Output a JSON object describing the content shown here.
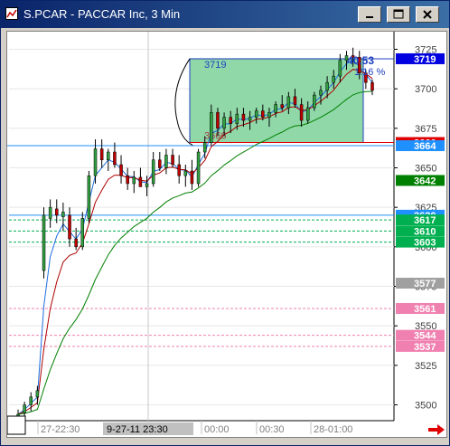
{
  "window": {
    "title": "S.PCAR - PACCAR Inc, 3 Min",
    "colors": {
      "titlebar_start": "#0a246a",
      "titlebar_end": "#3a6ea5"
    }
  },
  "title_buttons": [
    {
      "name": "minimize",
      "icon": "minimize-icon"
    },
    {
      "name": "maximize",
      "icon": "maximize-icon"
    },
    {
      "name": "close",
      "icon": "close-icon"
    }
  ],
  "chart_data": {
    "type": "candlestick",
    "price_axis": {
      "labels": [
        "3725",
        "3700",
        "3675",
        "3650",
        "3625",
        "3600",
        "3575",
        "3550",
        "3525",
        "3500"
      ],
      "ylim": [
        3490,
        3735
      ]
    },
    "time_axis": {
      "labels": [
        "27-22:30",
        "9-27-11  23:30",
        "00:00",
        "00:30",
        "28-01:00"
      ],
      "cursor_label": "9-27-11  23:30"
    },
    "price_markers": [
      {
        "value": 3719,
        "label": "3719",
        "color": "#0000e0"
      },
      {
        "value": 3666,
        "label": "3666",
        "color": "#e00000"
      },
      {
        "value": 3664,
        "label": "3664",
        "color": "#1e90ff"
      },
      {
        "value": 3642,
        "label": "3642",
        "color": "#008000"
      },
      {
        "value": 3620,
        "label": "3620",
        "color": "#1e90ff"
      },
      {
        "value": 3617,
        "label": "3617",
        "color": "#00b050"
      },
      {
        "value": 3610,
        "label": "3610",
        "color": "#00b050"
      },
      {
        "value": 3603,
        "label": "3603",
        "color": "#00b050"
      },
      {
        "value": 3577,
        "label": "3577",
        "color": "#a0a0a0"
      },
      {
        "value": 3561,
        "label": "3561",
        "color": "#f080b0"
      },
      {
        "value": 3544,
        "label": "3544",
        "color": "#f080b0"
      },
      {
        "value": 3537,
        "label": "3537",
        "color": "#f080b0"
      }
    ],
    "zone": {
      "top": 3719,
      "bottom": 3666,
      "top_label": "3719",
      "bottom_label": "3666",
      "color": "#90d8a8"
    },
    "annotation": {
      "price": "40.53",
      "percent": "1.16 %"
    },
    "candles": [
      {
        "o": 3492,
        "h": 3497,
        "l": 3488,
        "c": 3494
      },
      {
        "o": 3495,
        "h": 3502,
        "l": 3491,
        "c": 3500
      },
      {
        "o": 3500,
        "h": 3508,
        "l": 3496,
        "c": 3505
      },
      {
        "o": 3505,
        "h": 3512,
        "l": 3500,
        "c": 3509
      },
      {
        "o": 3585,
        "h": 3625,
        "l": 3580,
        "c": 3620
      },
      {
        "o": 3618,
        "h": 3630,
        "l": 3612,
        "c": 3625
      },
      {
        "o": 3624,
        "h": 3630,
        "l": 3615,
        "c": 3620
      },
      {
        "o": 3619,
        "h": 3628,
        "l": 3610,
        "c": 3622
      },
      {
        "o": 3620,
        "h": 3625,
        "l": 3600,
        "c": 3605
      },
      {
        "o": 3605,
        "h": 3612,
        "l": 3598,
        "c": 3600
      },
      {
        "o": 3600,
        "h": 3622,
        "l": 3598,
        "c": 3618
      },
      {
        "o": 3618,
        "h": 3648,
        "l": 3615,
        "c": 3645
      },
      {
        "o": 3645,
        "h": 3668,
        "l": 3640,
        "c": 3662
      },
      {
        "o": 3662,
        "h": 3668,
        "l": 3650,
        "c": 3655
      },
      {
        "o": 3655,
        "h": 3662,
        "l": 3648,
        "c": 3660
      },
      {
        "o": 3660,
        "h": 3666,
        "l": 3650,
        "c": 3652
      },
      {
        "o": 3652,
        "h": 3658,
        "l": 3640,
        "c": 3645
      },
      {
        "o": 3645,
        "h": 3650,
        "l": 3636,
        "c": 3640
      },
      {
        "o": 3640,
        "h": 3648,
        "l": 3634,
        "c": 3644
      },
      {
        "o": 3644,
        "h": 3650,
        "l": 3638,
        "c": 3638
      },
      {
        "o": 3638,
        "h": 3645,
        "l": 3632,
        "c": 3640
      },
      {
        "o": 3640,
        "h": 3660,
        "l": 3638,
        "c": 3655
      },
      {
        "o": 3655,
        "h": 3660,
        "l": 3648,
        "c": 3650
      },
      {
        "o": 3650,
        "h": 3662,
        "l": 3646,
        "c": 3658
      },
      {
        "o": 3658,
        "h": 3662,
        "l": 3650,
        "c": 3652
      },
      {
        "o": 3652,
        "h": 3658,
        "l": 3640,
        "c": 3645
      },
      {
        "o": 3645,
        "h": 3652,
        "l": 3638,
        "c": 3648
      },
      {
        "o": 3648,
        "h": 3655,
        "l": 3636,
        "c": 3640
      },
      {
        "o": 3640,
        "h": 3662,
        "l": 3638,
        "c": 3660
      },
      {
        "o": 3660,
        "h": 3670,
        "l": 3656,
        "c": 3666
      },
      {
        "o": 3666,
        "h": 3690,
        "l": 3664,
        "c": 3685
      },
      {
        "o": 3685,
        "h": 3688,
        "l": 3670,
        "c": 3675
      },
      {
        "o": 3675,
        "h": 3685,
        "l": 3670,
        "c": 3682
      },
      {
        "o": 3682,
        "h": 3686,
        "l": 3672,
        "c": 3678
      },
      {
        "o": 3678,
        "h": 3688,
        "l": 3674,
        "c": 3684
      },
      {
        "o": 3684,
        "h": 3688,
        "l": 3676,
        "c": 3680
      },
      {
        "o": 3680,
        "h": 3686,
        "l": 3674,
        "c": 3682
      },
      {
        "o": 3682,
        "h": 3688,
        "l": 3678,
        "c": 3686
      },
      {
        "o": 3686,
        "h": 3690,
        "l": 3680,
        "c": 3682
      },
      {
        "o": 3682,
        "h": 3688,
        "l": 3676,
        "c": 3685
      },
      {
        "o": 3685,
        "h": 3692,
        "l": 3682,
        "c": 3690
      },
      {
        "o": 3690,
        "h": 3696,
        "l": 3686,
        "c": 3688
      },
      {
        "o": 3688,
        "h": 3698,
        "l": 3684,
        "c": 3695
      },
      {
        "o": 3695,
        "h": 3700,
        "l": 3688,
        "c": 3690
      },
      {
        "o": 3690,
        "h": 3694,
        "l": 3676,
        "c": 3680
      },
      {
        "o": 3680,
        "h": 3692,
        "l": 3678,
        "c": 3688
      },
      {
        "o": 3688,
        "h": 3698,
        "l": 3686,
        "c": 3696
      },
      {
        "o": 3696,
        "h": 3702,
        "l": 3690,
        "c": 3699
      },
      {
        "o": 3699,
        "h": 3708,
        "l": 3694,
        "c": 3704
      },
      {
        "o": 3704,
        "h": 3712,
        "l": 3700,
        "c": 3708
      },
      {
        "o": 3708,
        "h": 3722,
        "l": 3704,
        "c": 3718
      },
      {
        "o": 3718,
        "h": 3724,
        "l": 3712,
        "c": 3721
      },
      {
        "o": 3721,
        "h": 3726,
        "l": 3714,
        "c": 3720
      },
      {
        "o": 3720,
        "h": 3724,
        "l": 3706,
        "c": 3710
      },
      {
        "o": 3710,
        "h": 3712,
        "l": 3700,
        "c": 3704
      },
      {
        "o": 3704,
        "h": 3706,
        "l": 3696,
        "c": 3699
      }
    ],
    "indicators": [
      {
        "name": "blue",
        "color": "#1e6ee0"
      },
      {
        "name": "red",
        "color": "#b00000"
      },
      {
        "name": "green",
        "color": "#008000"
      }
    ],
    "grid": true,
    "colors": {
      "bull": "#30a040",
      "bear": "#c00000",
      "wick": "#000000"
    }
  },
  "status_arrow": {
    "icon": "arrow-right-icon",
    "color": "#e00000"
  }
}
